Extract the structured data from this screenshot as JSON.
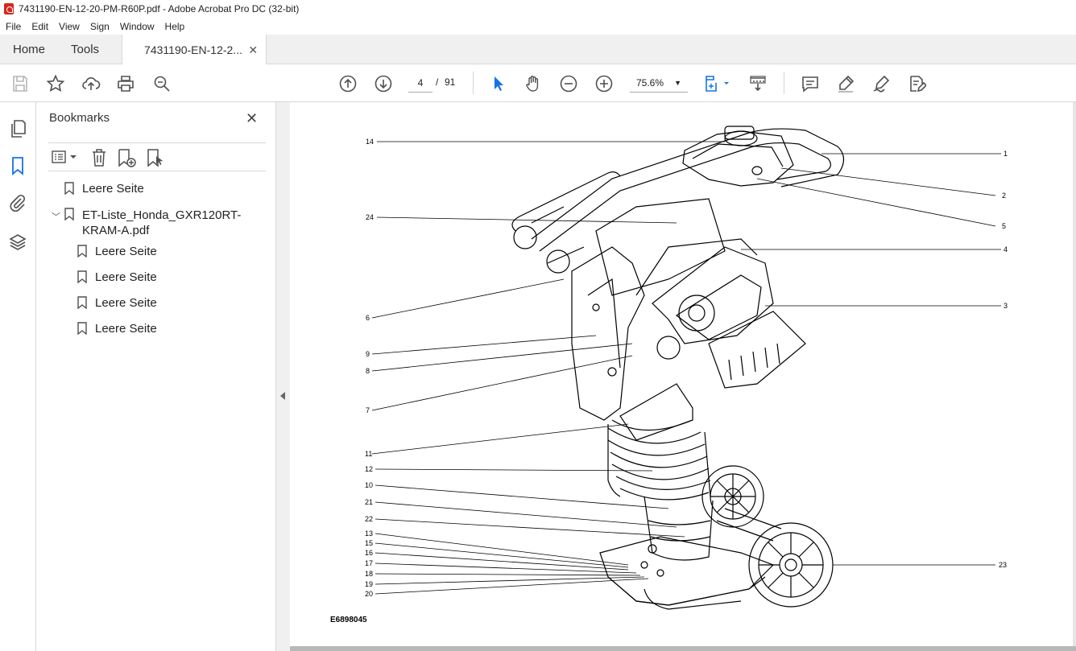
{
  "window": {
    "title": "7431190-EN-12-20-PM-R60P.pdf - Adobe Acrobat Pro DC (32-bit)"
  },
  "menu": [
    "File",
    "Edit",
    "View",
    "Sign",
    "Window",
    "Help"
  ],
  "tabs": {
    "home": "Home",
    "tools": "Tools",
    "document": "7431190-EN-12-2...",
    "close": "✕"
  },
  "toolbar": {
    "current_page": "4",
    "separator": "/",
    "total_pages": "91",
    "zoom": "75.6%"
  },
  "bookmarks": {
    "title": "Bookmarks",
    "items": [
      {
        "label": "Leere Seite",
        "level": 0
      },
      {
        "label": "ET-Liste_Honda_GXR120RT-KRAM-A.pdf",
        "level": 0,
        "expanded": true
      },
      {
        "label": "Leere Seite",
        "level": 1
      },
      {
        "label": "Leere Seite",
        "level": 1
      },
      {
        "label": "Leere Seite",
        "level": 1
      },
      {
        "label": "Leere Seite",
        "level": 1
      }
    ]
  },
  "figure": {
    "code": "E6898045",
    "callouts_left": [
      "14",
      "24",
      "6",
      "9",
      "8",
      "7",
      "11",
      "12",
      "10",
      "21",
      "22",
      "13",
      "15",
      "16",
      "17",
      "18",
      "19",
      "20"
    ],
    "callouts_right": [
      "1",
      "2",
      "5",
      "4",
      "3",
      "23"
    ]
  },
  "colors": {
    "accent": "#1473e6",
    "icon": "#505050",
    "pdf_red": "#d7261e"
  }
}
